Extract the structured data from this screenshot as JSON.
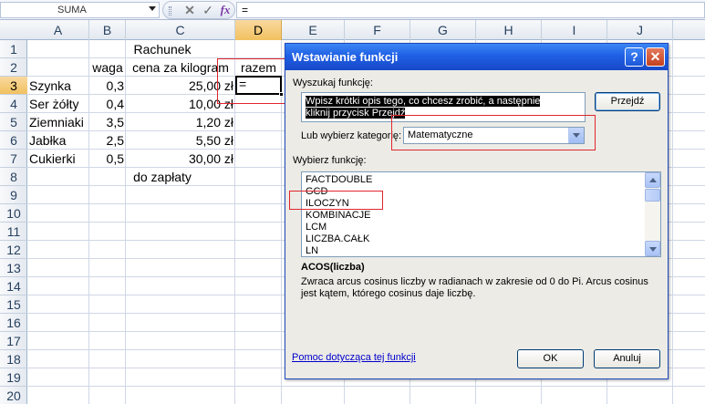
{
  "formula_bar": {
    "name_box": "SUMA",
    "cancel_glyph": "✕",
    "enter_glyph": "✓",
    "fx_label": "fx",
    "formula": "="
  },
  "columns": [
    "A",
    "B",
    "C",
    "D",
    "E",
    "F",
    "G",
    "H",
    "I",
    "J"
  ],
  "rows": [
    "1",
    "2",
    "3",
    "4",
    "5",
    "6",
    "7",
    "8",
    "9",
    "10",
    "11",
    "12",
    "13",
    "14",
    "15",
    "16",
    "17",
    "18",
    "19",
    "20",
    "21"
  ],
  "sheet": {
    "title": "Rachunek",
    "headers": {
      "weight": "waga",
      "price": "cena za kilogram",
      "total": "razem"
    },
    "items": [
      {
        "name": "Szynka",
        "weight": "0,3",
        "price": "25,00 zł"
      },
      {
        "name": "Ser żółty",
        "weight": "0,4",
        "price": "10,00 zł"
      },
      {
        "name": "Ziemniaki",
        "weight": "3,5",
        "price": "1,20 zł"
      },
      {
        "name": "Jabłka",
        "weight": "2,5",
        "price": "5,50 zł"
      },
      {
        "name": "Cukierki",
        "weight": "0,5",
        "price": "30,00 zł"
      }
    ],
    "footer": "do zapłaty",
    "active_cell_value": "="
  },
  "dialog": {
    "title": "Wstawianie funkcji",
    "help_glyph": "?",
    "close_glyph": "✕",
    "search_label": "Wyszukaj funkcję:",
    "search_value": "Wpisz krótki opis tego, co chcesz zrobić, a następnie kliknij przycisk Przejdź",
    "go_button": "Przejdź",
    "category_label": "Lub wybierz kategorię:",
    "category_value": "Matematyczne",
    "functions_label": "Wybierz funkcję:",
    "functions": [
      "FACTDOUBLE",
      "GCD",
      "ILOCZYN",
      "KOMBINACJE",
      "LCM",
      "LICZBA.CAŁK",
      "LN"
    ],
    "signature": "ACOS(liczba)",
    "description": "Zwraca arcus cosinus liczby w radianach w zakresie od 0 do Pi. Arcus cosinus jest kątem, którego cosinus daje liczbę.",
    "help_link": "Pomoc dotycząca tej funkcji",
    "ok_button": "OK",
    "cancel_button": "Anuluj"
  }
}
